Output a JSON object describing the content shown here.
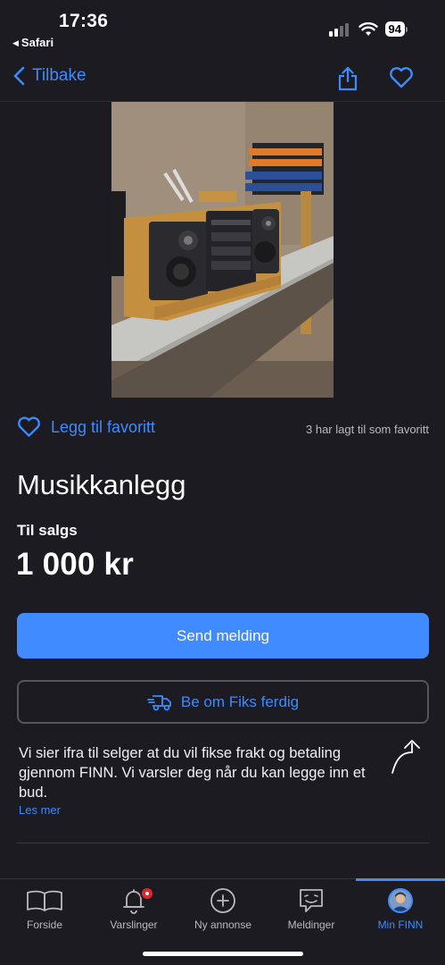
{
  "status_bar": {
    "time": "17:36",
    "back_app": "Safari",
    "battery": "94"
  },
  "nav": {
    "back_label": "Tilbake"
  },
  "favorite": {
    "label": "Legg til favoritt",
    "count_text": "3 har lagt til som favoritt"
  },
  "listing": {
    "title": "Musikkanlegg",
    "type": "Til salgs",
    "price": "1 000 kr"
  },
  "actions": {
    "send_label": "Send melding",
    "fiks_label": "Be om Fiks ferdig"
  },
  "info": {
    "text": "Vi sier ifra til selger at du vil fikse frakt og betaling gjennom FINN. Vi varsler deg når du kan legge inn et bud.",
    "read_more": "Les mer"
  },
  "tabs": [
    {
      "label": "Forside",
      "icon": "book-icon"
    },
    {
      "label": "Varslinger",
      "icon": "bell-icon"
    },
    {
      "label": "Ny annonse",
      "icon": "plus-circle-icon"
    },
    {
      "label": "Meldinger",
      "icon": "chat-icon"
    },
    {
      "label": "Min FINN",
      "icon": "avatar"
    }
  ],
  "colors": {
    "accent": "#3f8bff",
    "background": "#1b1b21",
    "badge": "#e0262b"
  }
}
